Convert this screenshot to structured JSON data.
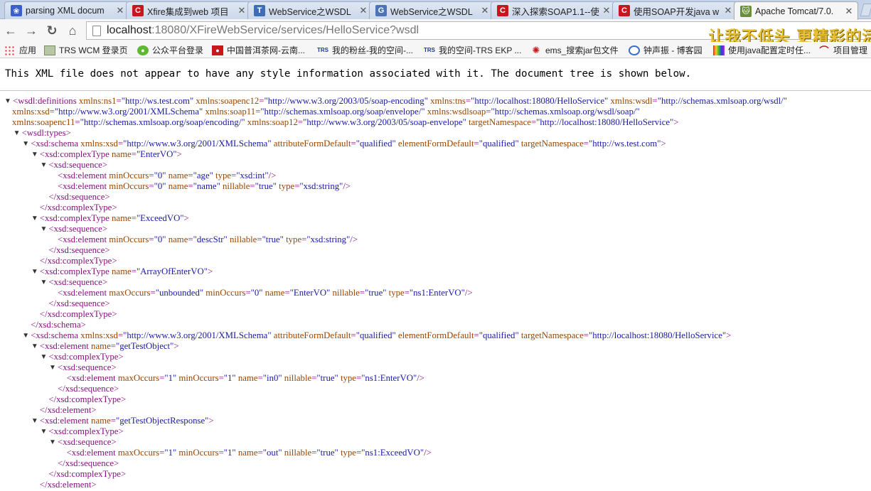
{
  "tabs": [
    {
      "title": "parsing XML docum",
      "icon": "paw-icon"
    },
    {
      "title": "Xfire集成到web 项目",
      "icon": "csdn-icon"
    },
    {
      "title": "WebService之WSDL",
      "icon": "t-icon"
    },
    {
      "title": "WebService之WSDL",
      "icon": "g-icon"
    },
    {
      "title": "深入探索SOAP1.1--使",
      "icon": "csdn-icon"
    },
    {
      "title": "使用SOAP开发java w",
      "icon": "csdn-icon"
    },
    {
      "title": "Apache Tomcat/7.0.",
      "icon": "tomcat-icon"
    }
  ],
  "toolbar": {
    "url_host": "localhost",
    "url_rest": ":18080/XFireWebService/services/HelloService?wsdl",
    "banner": "让我不低头  更精彩的活"
  },
  "bookmarks": [
    {
      "label": "应用",
      "icon": "apps-icon"
    },
    {
      "label": "TRS WCM 登录页",
      "icon": "image-icon"
    },
    {
      "label": "公众平台登录",
      "icon": "wechat-icon"
    },
    {
      "label": "中国普洱茶网-云南...",
      "icon": "red-logo-icon"
    },
    {
      "label": "我的粉丝-我的空间-...",
      "icon": "trs-icon"
    },
    {
      "label": "我的空间-TRS EKP ...",
      "icon": "trs-icon"
    },
    {
      "label": "ems_搜索jar包文件",
      "icon": "phoenix-icon"
    },
    {
      "label": "钟声振 - 博客园",
      "icon": "circle-g-icon"
    },
    {
      "label": "使用java配置定时任...",
      "icon": "rainbow-icon"
    },
    {
      "label": "项目管理",
      "icon": "arc-icon"
    }
  ],
  "info_message": "This XML file does not appear to have any style information associated with it. The document tree is shown below.",
  "xml_lines": [
    {
      "i": 0,
      "t": "▼",
      "x": "<wsdl:definitions xmlns:ns1=\"http://ws.test.com\" xmlns:soapenc12=\"http://www.w3.org/2003/05/soap-encoding\" xmlns:tns=\"http://localhost:18080/HelloService\" xmlns:wsdl=\"http://schemas.xmlsoap.org/wsdl/\""
    },
    {
      "i": 0,
      "t": "",
      "x": " xmlns:xsd=\"http://www.w3.org/2001/XMLSchema\" xmlns:soap11=\"http://schemas.xmlsoap.org/soap/envelope/\" xmlns:wsdlsoap=\"http://schemas.xmlsoap.org/wsdl/soap/\""
    },
    {
      "i": 0,
      "t": "",
      "x": " xmlns:soapenc11=\"http://schemas.xmlsoap.org/soap/encoding/\" xmlns:soap12=\"http://www.w3.org/2003/05/soap-envelope\" targetNamespace=\"http://localhost:18080/HelloService\">"
    },
    {
      "i": 1,
      "t": "▼",
      "x": "<wsdl:types>"
    },
    {
      "i": 2,
      "t": "▼",
      "x": "<xsd:schema xmlns:xsd=\"http://www.w3.org/2001/XMLSchema\" attributeFormDefault=\"qualified\" elementFormDefault=\"qualified\" targetNamespace=\"http://ws.test.com\">"
    },
    {
      "i": 3,
      "t": "▼",
      "x": "<xsd:complexType name=\"EnterVO\">"
    },
    {
      "i": 4,
      "t": "▼",
      "x": "<xsd:sequence>"
    },
    {
      "i": 5,
      "t": "",
      "x": "<xsd:element minOccurs=\"0\" name=\"age\" type=\"xsd:int\"/>"
    },
    {
      "i": 5,
      "t": "",
      "x": "<xsd:element minOccurs=\"0\" name=\"name\" nillable=\"true\" type=\"xsd:string\"/>"
    },
    {
      "i": 4,
      "t": "",
      "x": "</xsd:sequence>"
    },
    {
      "i": 3,
      "t": "",
      "x": "</xsd:complexType>"
    },
    {
      "i": 3,
      "t": "▼",
      "x": "<xsd:complexType name=\"ExceedVO\">"
    },
    {
      "i": 4,
      "t": "▼",
      "x": "<xsd:sequence>"
    },
    {
      "i": 5,
      "t": "",
      "x": "<xsd:element minOccurs=\"0\" name=\"descStr\" nillable=\"true\" type=\"xsd:string\"/>"
    },
    {
      "i": 4,
      "t": "",
      "x": "</xsd:sequence>"
    },
    {
      "i": 3,
      "t": "",
      "x": "</xsd:complexType>"
    },
    {
      "i": 3,
      "t": "▼",
      "x": "<xsd:complexType name=\"ArrayOfEnterVO\">"
    },
    {
      "i": 4,
      "t": "▼",
      "x": "<xsd:sequence>"
    },
    {
      "i": 5,
      "t": "",
      "x": "<xsd:element maxOccurs=\"unbounded\" minOccurs=\"0\" name=\"EnterVO\" nillable=\"true\" type=\"ns1:EnterVO\"/>"
    },
    {
      "i": 4,
      "t": "",
      "x": "</xsd:sequence>"
    },
    {
      "i": 3,
      "t": "",
      "x": "</xsd:complexType>"
    },
    {
      "i": 2,
      "t": "",
      "x": "</xsd:schema>"
    },
    {
      "i": 2,
      "t": "▼",
      "x": "<xsd:schema xmlns:xsd=\"http://www.w3.org/2001/XMLSchema\" attributeFormDefault=\"qualified\" elementFormDefault=\"qualified\" targetNamespace=\"http://localhost:18080/HelloService\">"
    },
    {
      "i": 3,
      "t": "▼",
      "x": "<xsd:element name=\"getTestObject\">"
    },
    {
      "i": 4,
      "t": "▼",
      "x": "<xsd:complexType>"
    },
    {
      "i": 5,
      "t": "▼",
      "x": "<xsd:sequence>"
    },
    {
      "i": 6,
      "t": "",
      "x": "<xsd:element maxOccurs=\"1\" minOccurs=\"1\" name=\"in0\" nillable=\"true\" type=\"ns1:EnterVO\"/>"
    },
    {
      "i": 5,
      "t": "",
      "x": "</xsd:sequence>"
    },
    {
      "i": 4,
      "t": "",
      "x": "</xsd:complexType>"
    },
    {
      "i": 3,
      "t": "",
      "x": "</xsd:element>"
    },
    {
      "i": 3,
      "t": "▼",
      "x": "<xsd:element name=\"getTestObjectResponse\">"
    },
    {
      "i": 4,
      "t": "▼",
      "x": "<xsd:complexType>"
    },
    {
      "i": 5,
      "t": "▼",
      "x": "<xsd:sequence>"
    },
    {
      "i": 6,
      "t": "",
      "x": "<xsd:element maxOccurs=\"1\" minOccurs=\"1\" name=\"out\" nillable=\"true\" type=\"ns1:ExceedVO\"/>"
    },
    {
      "i": 5,
      "t": "",
      "x": "</xsd:sequence>"
    },
    {
      "i": 4,
      "t": "",
      "x": "</xsd:complexType>"
    },
    {
      "i": 3,
      "t": "",
      "x": "</xsd:element>"
    }
  ]
}
